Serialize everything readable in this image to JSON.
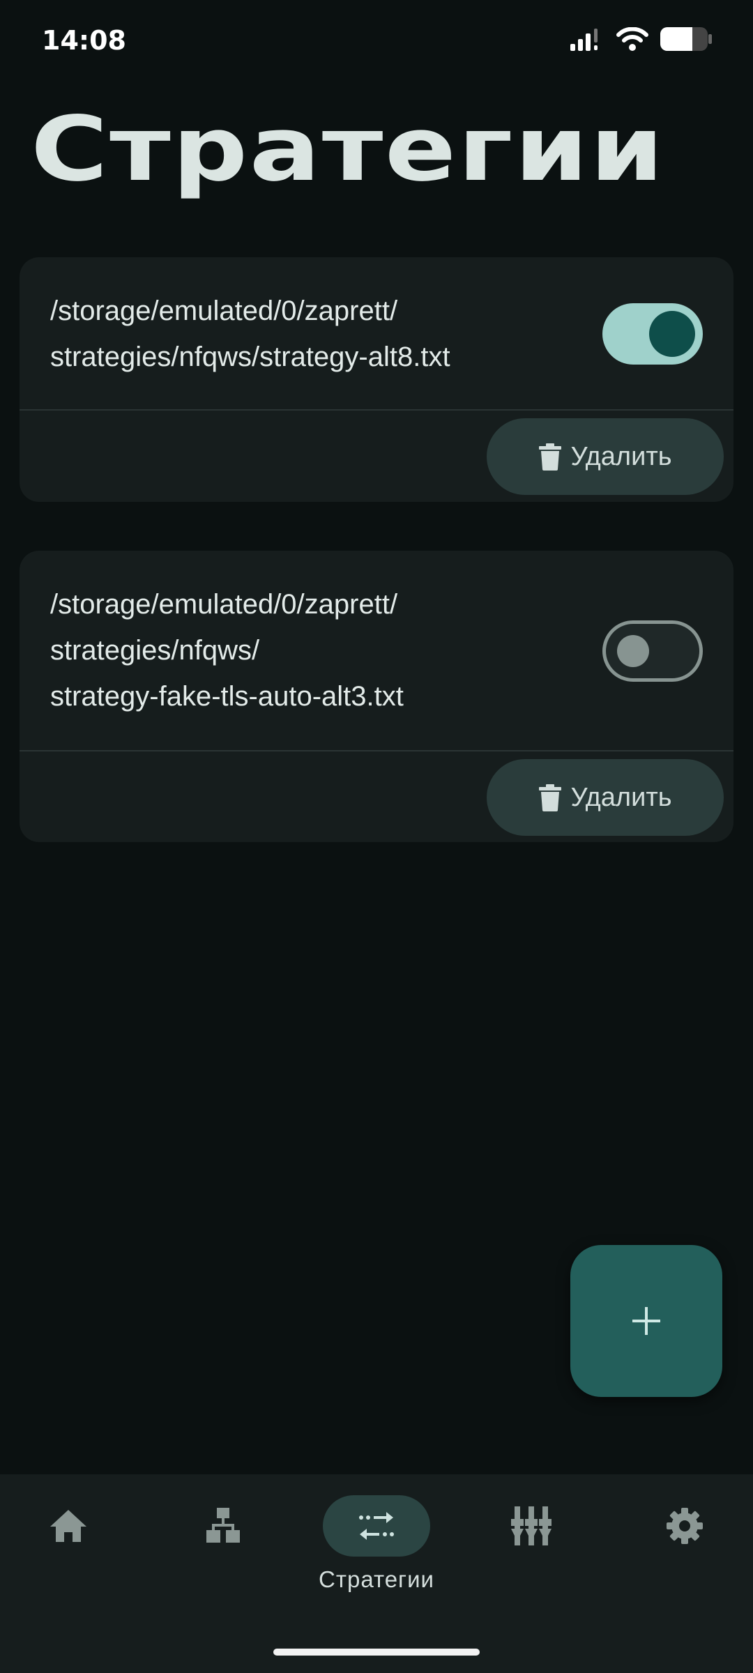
{
  "status_bar": {
    "time": "14:08"
  },
  "page": {
    "title": "Стратегии"
  },
  "strategies": [
    {
      "path": "/storage/emulated/0/zaprett/\nstrategies/nfqws/strategy-alt8.txt",
      "enabled": true,
      "delete_label": "Удалить"
    },
    {
      "path": "/storage/emulated/0/zaprett/\nstrategies/nfqws/\nstrategy-fake-tls-auto-alt3.txt",
      "enabled": false,
      "delete_label": "Удалить"
    }
  ],
  "fab": {
    "icon": "plus-icon"
  },
  "nav": {
    "items": [
      {
        "icon": "home-icon",
        "label": ""
      },
      {
        "icon": "hosts-tree-icon",
        "label": ""
      },
      {
        "icon": "strategies-arrows-icon",
        "label": "Стратегии",
        "active": true
      },
      {
        "icon": "equalizer-icon",
        "label": ""
      },
      {
        "icon": "settings-gear-icon",
        "label": ""
      }
    ]
  },
  "colors": {
    "accent": "#9fd1cb",
    "background": "#0b1111",
    "card": "#161d1d",
    "fab": "#235f5b"
  }
}
